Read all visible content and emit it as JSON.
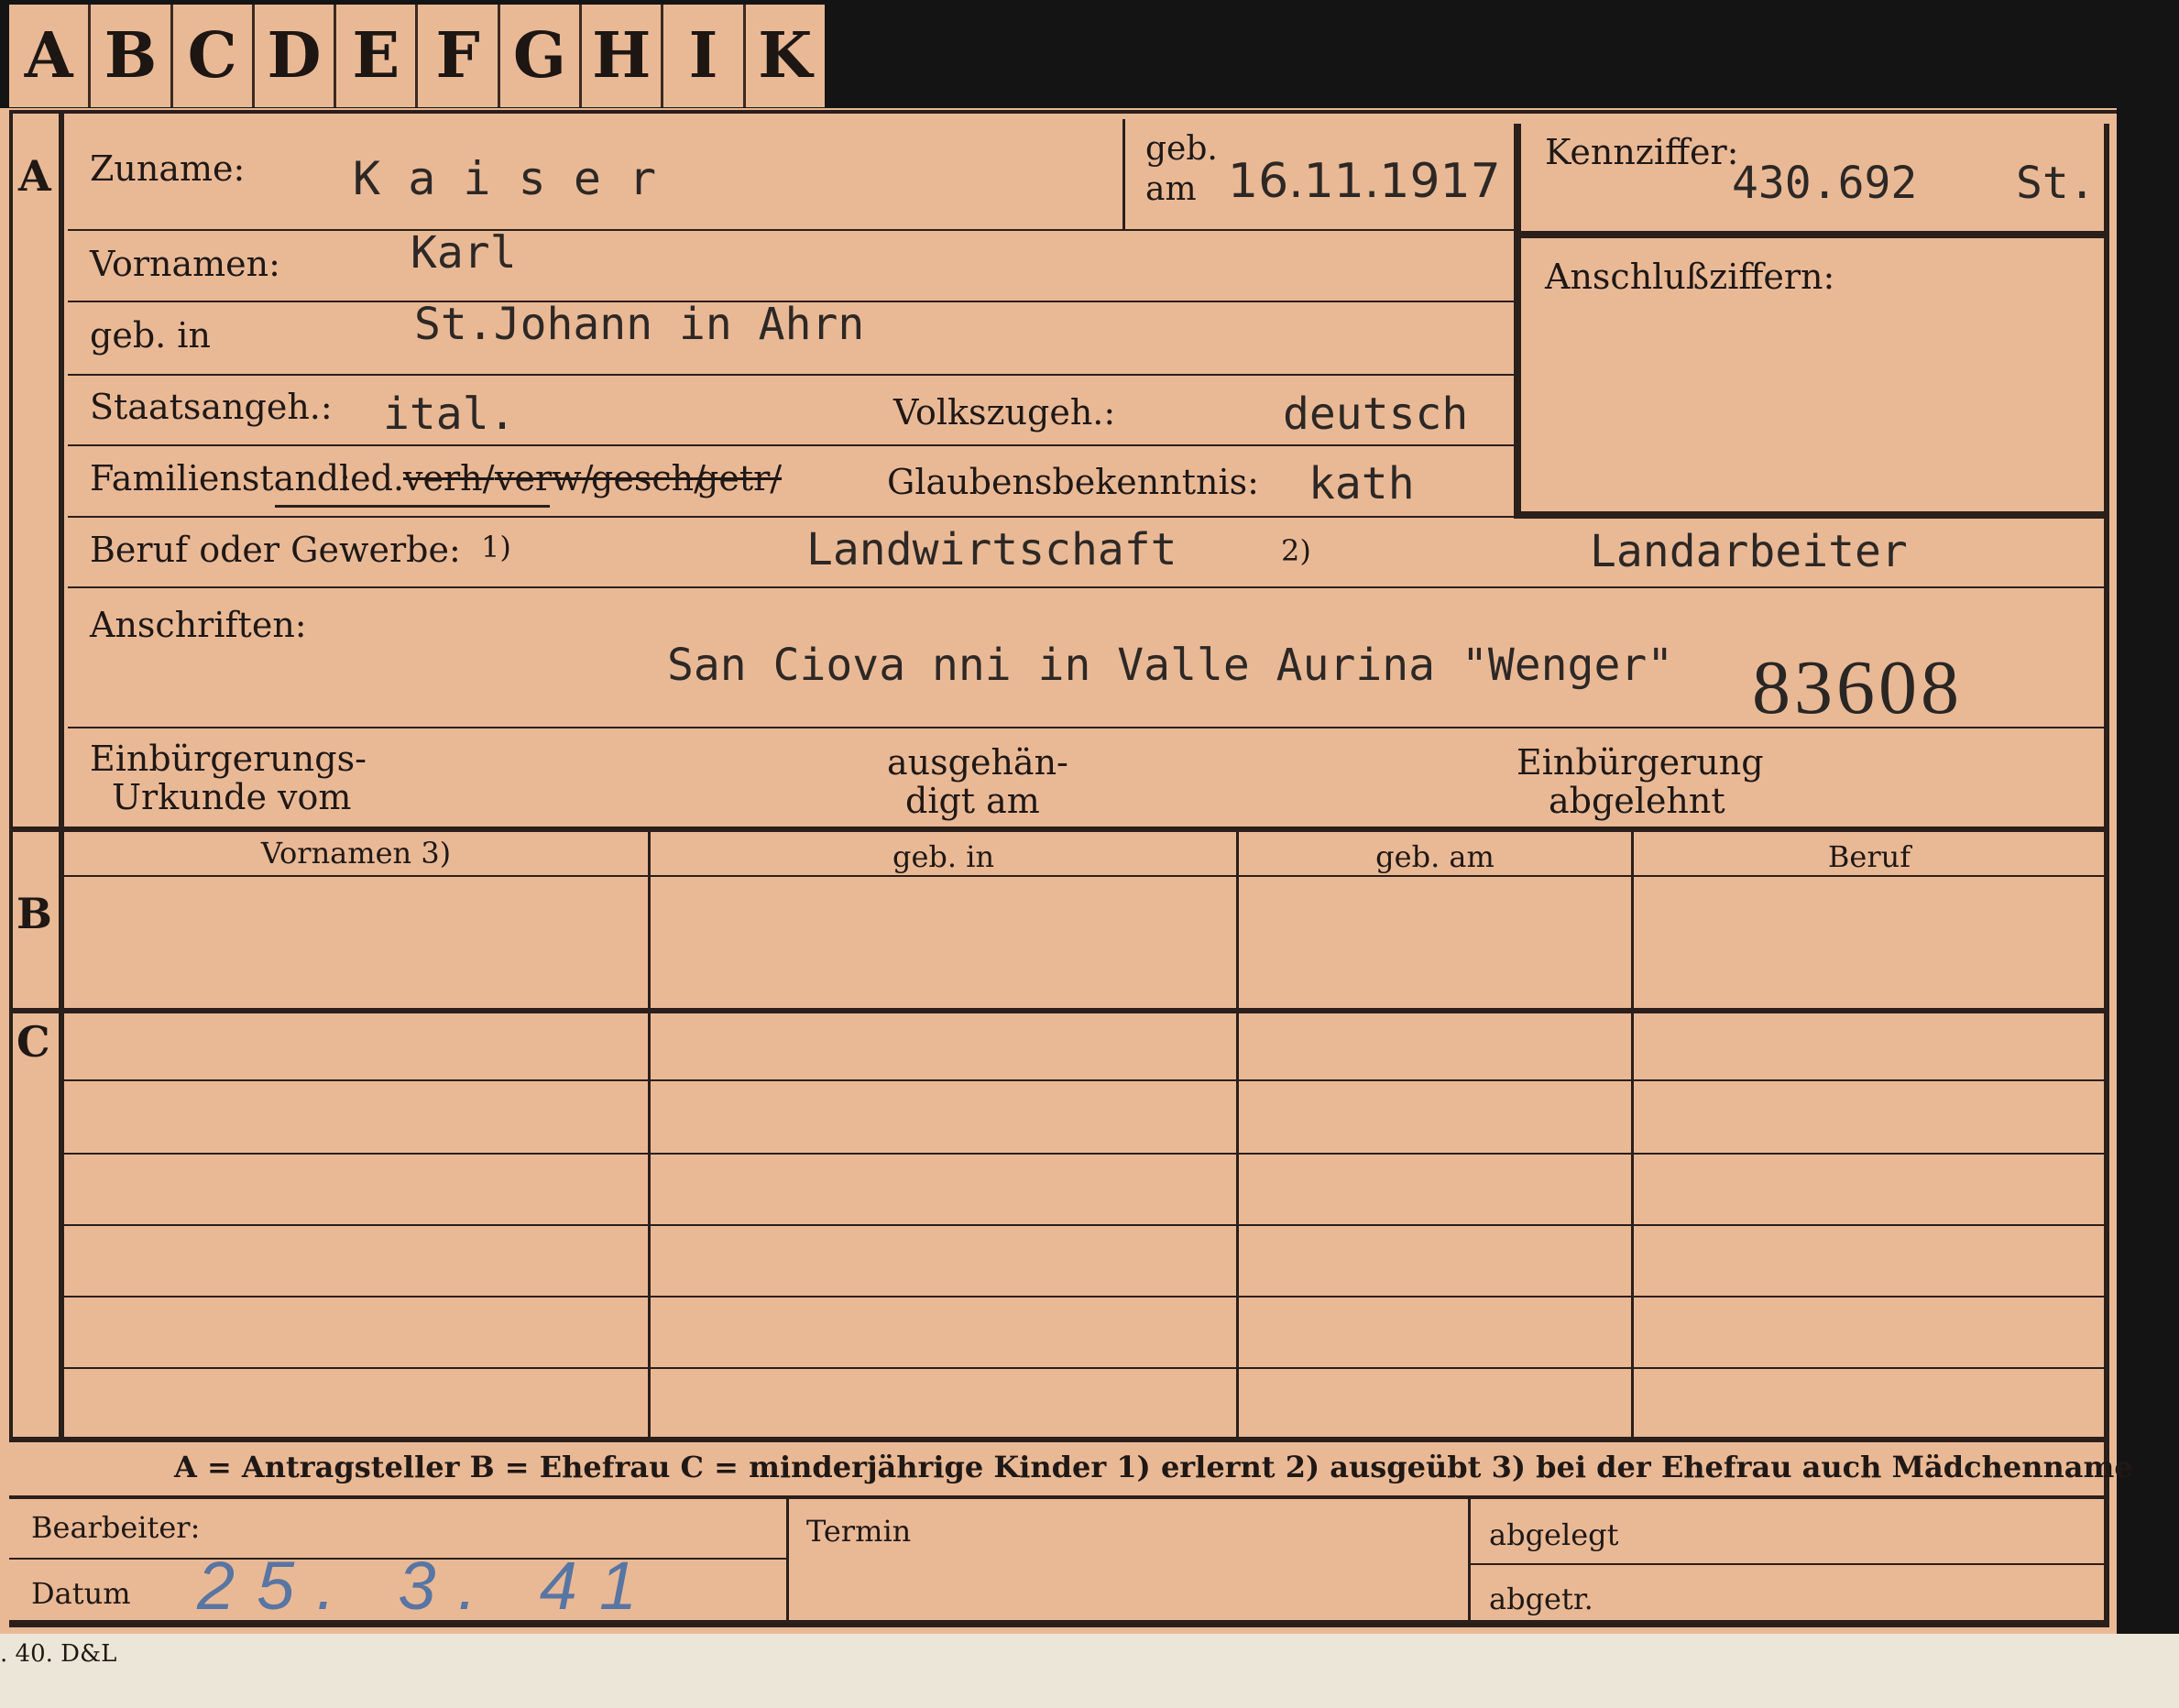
{
  "tabs": [
    "A",
    "B",
    "C",
    "D",
    "E",
    "F",
    "G",
    "H",
    "I",
    "K"
  ],
  "section_letters": {
    "a": "A",
    "b": "B",
    "c": "C"
  },
  "header": {
    "surname_label": "Zuname:",
    "surname_value": "K a i s e r",
    "born_label_1": "geb.",
    "born_label_2": "am",
    "born_value": "16.11.1917",
    "kennziffer_label": "Kennziffer:",
    "kennziffer_value": "430.692",
    "kennziffer_suffix": "St.",
    "anschluss_label": "Anschlußziffern:"
  },
  "fields": {
    "vornamen_label": "Vornamen:",
    "vornamen_value": "Karl",
    "geb_in_label": "geb. in",
    "geb_in_value": "St.Johann in Ahrn",
    "staatsangeh_label": "Staatsangeh.:",
    "staatsangeh_value": "ital.",
    "volkszugeh_label": "Volkszugeh.:",
    "volkszugeh_value": "deutsch",
    "familienstand_label": "Familienstand:",
    "familienstand_options": [
      "led.",
      "verh/",
      "verw/",
      "gesch/",
      "getr/"
    ],
    "glauben_label": "Glaubensbekenntnis:",
    "glauben_value": "kath",
    "beruf_label": "Beruf oder Gewerbe:",
    "beruf_mark1": "1)",
    "beruf_value1": "Landwirtschaft",
    "beruf_mark2": "2)",
    "beruf_value2": "Landarbeiter",
    "anschriften_label": "Anschriften:",
    "anschriften_value": "San Ciova nni  in Valle Aurina \"Wenger\"",
    "stamp_number": "83608",
    "einb_urkunde_1": "Einbürgerungs-",
    "einb_urkunde_2": "Urkunde vom",
    "ausgehaen_1": "ausgehän-",
    "ausgehaen_2": "digt am",
    "einb_abgelehnt_1": "Einbürgerung",
    "einb_abgelehnt_2": "abgelehnt"
  },
  "table": {
    "headers": [
      "Vornamen 3)",
      "geb. in",
      "geb. am",
      "Beruf"
    ]
  },
  "legend": "A = Antragsteller   B = Ehefrau   C = minderjährige Kinder   1) erlernt   2) ausgeübt   3) bei der Ehefrau auch Mädchenname",
  "footer": {
    "bearbeiter_label": "Bearbeiter:",
    "datum_label": "Datum",
    "datum_value": "25. 3. 41",
    "termin_label": "Termin",
    "abgelegt_label": "abgelegt",
    "abgetr_label": "abgetr."
  },
  "print_code": ". 40. D&L"
}
